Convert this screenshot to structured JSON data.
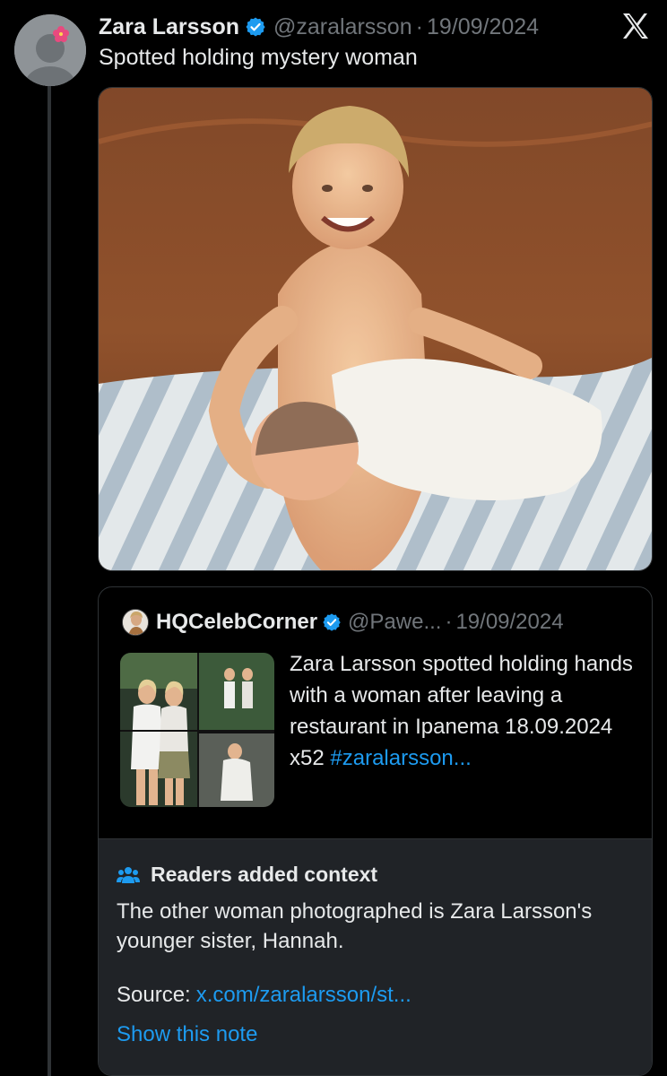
{
  "tweet": {
    "author_name": "Zara Larsson",
    "author_handle": "@zaralarsson",
    "separator": "·",
    "date": "19/09/2024",
    "text": "Spotted holding mystery woman",
    "verified_icon": "verified-badge-icon",
    "close_icon": "x-logo-icon"
  },
  "quote": {
    "author_name": "HQCelebCorner",
    "author_handle": "@Pawe...",
    "separator": "·",
    "date": "19/09/2024",
    "text": "Zara Larsson spotted holding hands with a woman after leaving a restaurant in Ipanema 18.09.2024 x52 ",
    "hashtag": "#zaralarsson..."
  },
  "community_note": {
    "title": "Readers added context",
    "body": "The other woman photographed is Zara Larsson's younger sister, Hannah.",
    "source_label": "Source:",
    "source_link": "x.com/zaralarsson/st...",
    "show_label": "Show this note"
  },
  "colors": {
    "background": "#000000",
    "text_primary": "#e7e9ea",
    "text_secondary": "#71767b",
    "link": "#1d9bf0",
    "note_background": "#202327",
    "border": "#2f3336"
  }
}
